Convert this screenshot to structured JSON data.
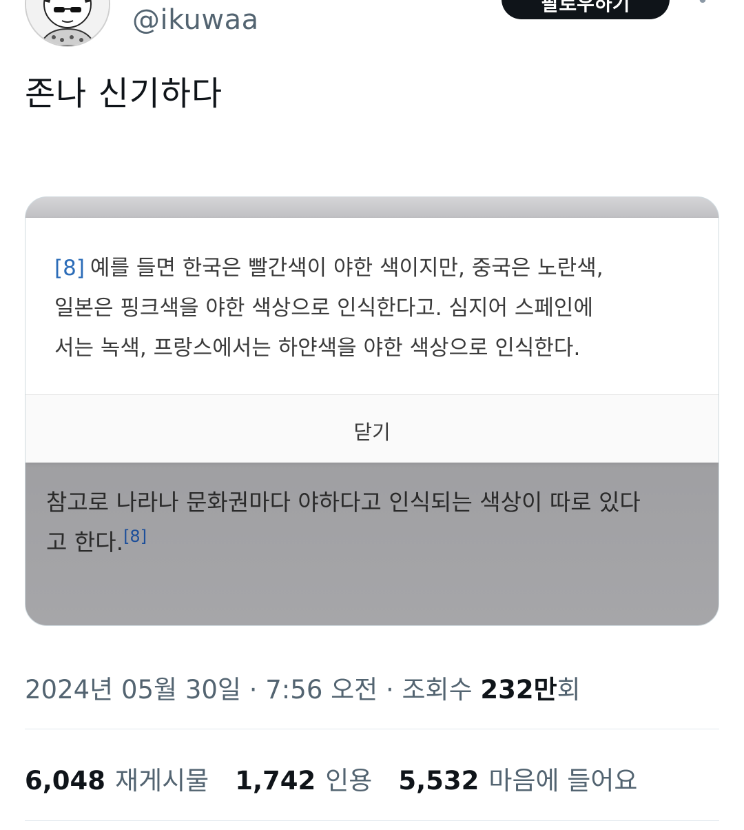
{
  "header": {
    "handle": "@ikuwaa",
    "follow_label": "팔로우하기",
    "more_icon": "more-dots-icon",
    "avatar_icon": "cartoon-avatar-icon"
  },
  "tweet": {
    "text": "존나 신기하다"
  },
  "media": {
    "footnote": {
      "ref": "[8]",
      "lines": [
        "예를 들면 한국은 빨간색이 야한 색이지만, 중국은 노란색,",
        "일본은 핑크색을 야한 색상으로 인식한다고. 심지어 스페인에",
        "서는 녹색, 프랑스에서는 하얀색을 야한 색상으로 인식한다."
      ],
      "close_label": "닫기"
    },
    "wiki": {
      "line1": "참고로 나라나 문화권마다 야하다고 인식되는 색상이 따로 있다",
      "line2": "고 한다.",
      "ref": "[8]",
      "ref_color": "#1d4f9a"
    }
  },
  "meta": {
    "date": "2024년 05월 30일",
    "separator": "·",
    "time": "7:56 오전",
    "views_label": "조회수",
    "views_count": "232만",
    "views_suffix": "회"
  },
  "stats": [
    {
      "count": "6,048",
      "label": "재게시물"
    },
    {
      "count": "1,742",
      "label": "인용"
    },
    {
      "count": "5,532",
      "label": "마음에 들어요"
    }
  ]
}
